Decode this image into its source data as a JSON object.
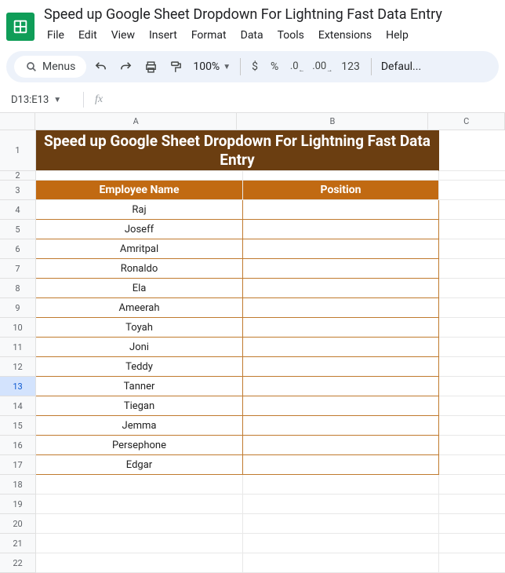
{
  "doc_title": "Speed up Google Sheet Dropdown For Lightning  Fast Data Entry",
  "menubar": [
    "File",
    "Edit",
    "View",
    "Insert",
    "Format",
    "Data",
    "Tools",
    "Extensions",
    "Help"
  ],
  "toolbar": {
    "menus_label": "Menus",
    "zoom": "100%",
    "font": "Defaul...",
    "num_inc": ".0",
    "num_dec": ".00",
    "num_123": "123"
  },
  "namebox": "D13:E13",
  "columns": [
    "A",
    "B",
    "C"
  ],
  "sheet": {
    "title_merged": "Speed up Google Sheet Dropdown For Lightning  Fast Data Entry",
    "header_A": "Employee Name",
    "header_B": "Position",
    "rows": [
      {
        "n": 4,
        "name": "Raj",
        "position": ""
      },
      {
        "n": 5,
        "name": "Joseff",
        "position": ""
      },
      {
        "n": 6,
        "name": "Amritpal",
        "position": ""
      },
      {
        "n": 7,
        "name": "Ronaldo",
        "position": ""
      },
      {
        "n": 8,
        "name": "Ela",
        "position": ""
      },
      {
        "n": 9,
        "name": "Ameerah",
        "position": ""
      },
      {
        "n": 10,
        "name": "Toyah",
        "position": ""
      },
      {
        "n": 11,
        "name": "Joni",
        "position": ""
      },
      {
        "n": 12,
        "name": "Teddy",
        "position": ""
      },
      {
        "n": 13,
        "name": "Tanner",
        "position": ""
      },
      {
        "n": 14,
        "name": "Tiegan",
        "position": ""
      },
      {
        "n": 15,
        "name": "Jemma",
        "position": ""
      },
      {
        "n": 16,
        "name": "Persephone",
        "position": ""
      },
      {
        "n": 17,
        "name": "Edgar",
        "position": ""
      }
    ],
    "empty_rows": [
      18,
      19,
      20,
      21,
      22
    ],
    "selected_row": 13
  }
}
